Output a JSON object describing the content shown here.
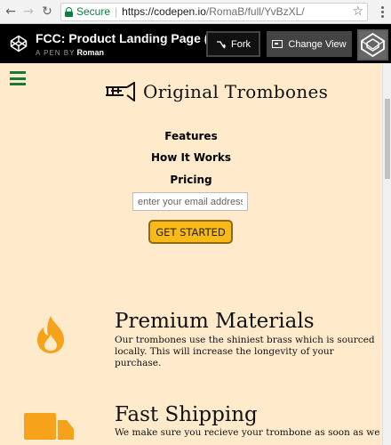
{
  "browser": {
    "secure_label": "Secure",
    "url_host": "https://codepen.io",
    "url_path": "/RomaB/full/YvBzXL/"
  },
  "codepen": {
    "title": "FCC: Product Landing Page (...",
    "byline_prefix": "A PEN BY",
    "author": "Roman",
    "fork_label": "Fork",
    "change_view_label": "Change View"
  },
  "site": {
    "brand": "Original Trombones",
    "nav": [
      "Features",
      "How It Works",
      "Pricing"
    ],
    "email_placeholder": "enter your email address",
    "cta_label": "GET STARTED"
  },
  "features": [
    {
      "title": "Premium Materials",
      "text": "Our trombones use the shiniest brass which is sourced locally. This will increase the longevity of your purchase.",
      "icon": "fire-icon"
    },
    {
      "title": "Fast Shipping",
      "text": "We make sure you recieve your trombone as soon as we",
      "icon": "truck-icon"
    }
  ],
  "colors": {
    "page_background": "#ffebcc",
    "accent": "#f9b916",
    "icon_orange": "#f7a21b",
    "hamburger_green": "#1a7a35"
  }
}
